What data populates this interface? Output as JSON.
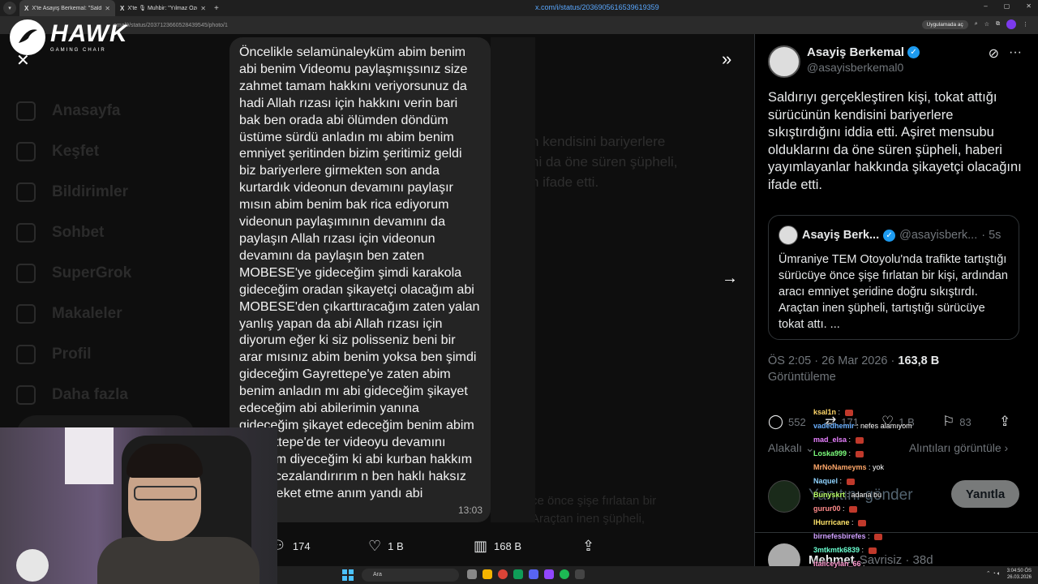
{
  "browser": {
    "tabs": [
      {
        "title": "X'te Asayiş Berkemal: \"Saldırıy...",
        "active": true
      },
      {
        "title": "X'te 🎙 Muhbir: \"Yılmaz Özdil...",
        "active": false
      }
    ],
    "url": "emal0/status/2037123660528439545/photo/1",
    "app_pill": "Uygulamada aç"
  },
  "overlay": {
    "brand_name": "HAWK",
    "brand_sub": "GAMING CHAIR"
  },
  "background_nav": {
    "items": [
      "Anasayfa",
      "Keşfet",
      "Bildirimler",
      "Sohbet",
      "SuperGrok",
      "Makaleler",
      "Profil",
      "Daha fazla"
    ]
  },
  "background_tweet": {
    "text": "n kendisini bariyerlere\nni da öne süren şüpheli,\nn ifade etti.",
    "bottom_text": "ce önce şişe fırlatan bir\nAraçtan inen şüpheli,"
  },
  "photo": {
    "message": "Öncelikle selamünaleyküm abim benim abi benim Videomu paylaşmışsınız size zahmet tamam hakkını veriyorsunuz da hadi Allah rızası için hakkını verin bari bak ben orada abi ölümden döndüm üstüme sürdü anladın mı abim benim emniyet şeritinden bizim şeritimiz geldi biz bariyerlere girmekten son anda kurtardık videonun devamını paylaşır mısın abim benim bak rica ediyorum videonun paylaşımının devamını da paylaşın Allah rızası için videonun devamını da paylaşın ben zaten MOBESE'ye gideceğim şimdi karakola gideceğim oradan şikayetçi olacağım abi MOBESE'den çıkarttıracağım zaten yalan yanlış yapan da abi Allah rızası için diyorum eğer ki siz polisseniz beni bir arar mısınız abim benim yoksa ben şimdi gideceğim Gayrettepe'ye zaten abim benim anladın mı abi gideceğim şikayet edeceğim abi abilerimin yanına gideceğim şikayet edeceğim benim abim Gayrettepe'de ter videoyu devamını racağım diyeceğim ki abi kurban hakkım varsa cezalandırırım n ben haklı haksız bir hareket etme anım yandı abi",
    "time": "13:03"
  },
  "viewer_actions": {
    "replies": "174",
    "likes": "1 B",
    "views": "168 B"
  },
  "tweet": {
    "author_name": "Asayiş Berkemal",
    "author_handle": "@asayisberkemal0",
    "body": "Saldırıyı gerçekleştiren kişi, tokat attığı sürücünün kendisini bariyerlere sıkıştırdığını iddia etti. Aşiret mensubu olduklarını da öne süren şüpheli, haberi yayımlayanlar hakkında şikayetçi olacağını ifade etti.",
    "quote": {
      "name": "Asayiş Berk...",
      "handle": "@asayisberk...",
      "time": "· 5s",
      "text": "Ümraniye TEM Otoyolu'nda trafikte tartıştığı sürücüye önce şişe fırlatan bir kişi, ardından aracı emniyet şeridine doğru sıkıştırdı. Araçtan inen şüpheli, tartıştığı sürücüye tokat attı. ..."
    },
    "timestamp": "ÖS 2:05 · 26 Mar 2026 · ",
    "views_count": "163,8 B",
    "views_label": "Görüntüleme",
    "engagement": {
      "replies": "552",
      "reposts": "171",
      "likes": "1 B",
      "bookmarks": "83"
    },
    "related_label": "Alakalı",
    "quotes_label": "Alıntıları görüntüle",
    "reply_placeholder": "Yanıtını gönder",
    "reply_button": "Yanıtla",
    "next_reply": {
      "name": "Mehmet",
      "meta": "Savrisiz · 38d"
    }
  },
  "chat": [
    {
      "user": "ksal1n",
      "message": ""
    },
    {
      "user": "vadedhemir",
      "message": "nefes alamıyom"
    },
    {
      "user": "mad_elsa",
      "message": ""
    },
    {
      "user": "Loska999",
      "message": ""
    },
    {
      "user": "MrNoNameyms",
      "message": "yok"
    },
    {
      "user": "Naquel",
      "message": ""
    },
    {
      "user": "Bunyskrt",
      "message": "adana bu"
    },
    {
      "user": "gurur00",
      "message": ""
    },
    {
      "user": "lHurricane",
      "message": ""
    },
    {
      "user": "birnefesbirefes",
      "message": ""
    },
    {
      "user": "3mtkmtk6839",
      "message": ""
    },
    {
      "user": "italiceylan_66",
      "message": ""
    }
  ],
  "taskbar": {
    "search": "Ara",
    "url_overlay": "x.com/i/status/2036905616539619359",
    "time": "3:04:50 ÖS",
    "date": "26.03.2026"
  }
}
